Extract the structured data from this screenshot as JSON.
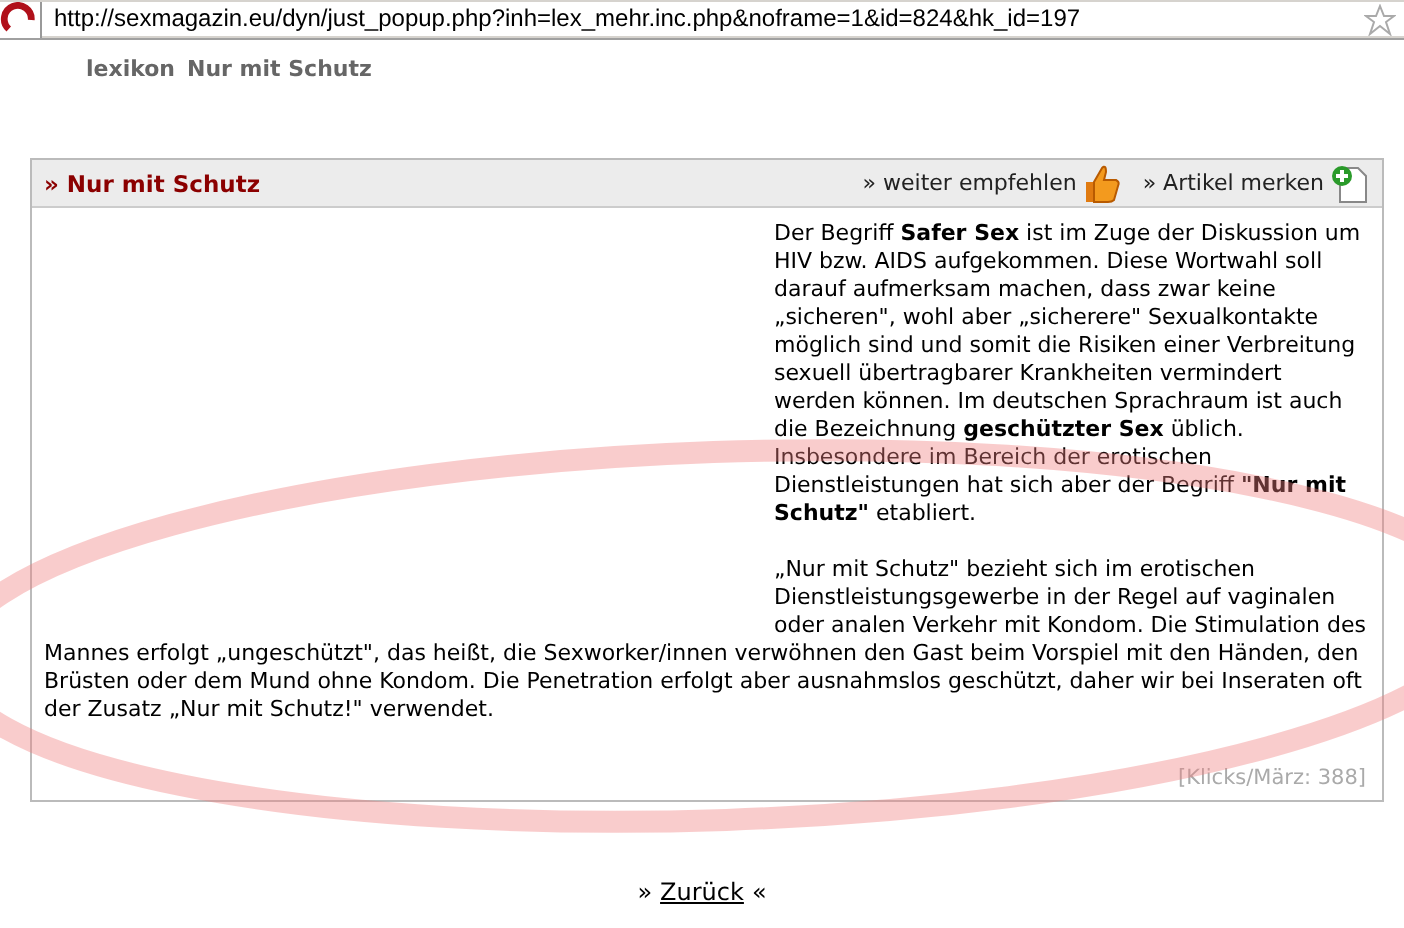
{
  "address_bar": {
    "url": "http://sexmagazin.eu/dyn/just_popup.php?inh=lex_mehr.inc.php&noframe=1&id=824&hk_id=197"
  },
  "breadcrumb": [
    "lexikon",
    "Nur mit Schutz"
  ],
  "article": {
    "title": "» Nur mit Schutz",
    "actions": [
      {
        "label": "» weiter empfehlen",
        "kind": "recommend"
      },
      {
        "label": "» Artikel merken",
        "kind": "bookmark"
      }
    ],
    "paragraphs": [
      "Der Begriff **Safer Sex** ist im Zuge der Diskussion um HIV bzw. AIDS aufgekommen. Diese Wortwahl soll darauf aufmerksam machen, dass zwar keine „sicheren\", wohl aber „sicherere\" Sexualkontakte möglich sind und somit die Risiken einer Verbreitung sexuell übertragbarer Krankheiten vermindert werden können. Im deutschen Sprachraum ist auch die Bezeichnung **geschützter Sex** üblich. Insbesondere im Bereich der erotischen Dienstleistungen hat sich aber der Begriff **\"Nur mit Schutz\"** etabliert.",
      "„Nur mit Schutz\" bezieht sich im erotischen Dienstleistungsgewerbe in der Regel auf vaginalen oder analen Verkehr mit Kondom. Die Stimulation des Mannes erfolgt „ungeschützt\", das heißt, die Sexworker/innen verwöhnen den Gast beim Vorspiel mit den Händen, den Brüsten oder dem Mund ohne Kondom. Die Penetration erfolgt aber ausnahmslos geschützt, daher wir bei Inseraten oft der Zusatz „Nur mit Schutz!\" verwendet."
    ],
    "clicks": "[Klicks/März: 388]"
  },
  "back_link": {
    "before": "»",
    "label": "Zurück",
    "after": "«"
  },
  "annotation": {
    "kind": "ellipse"
  }
}
